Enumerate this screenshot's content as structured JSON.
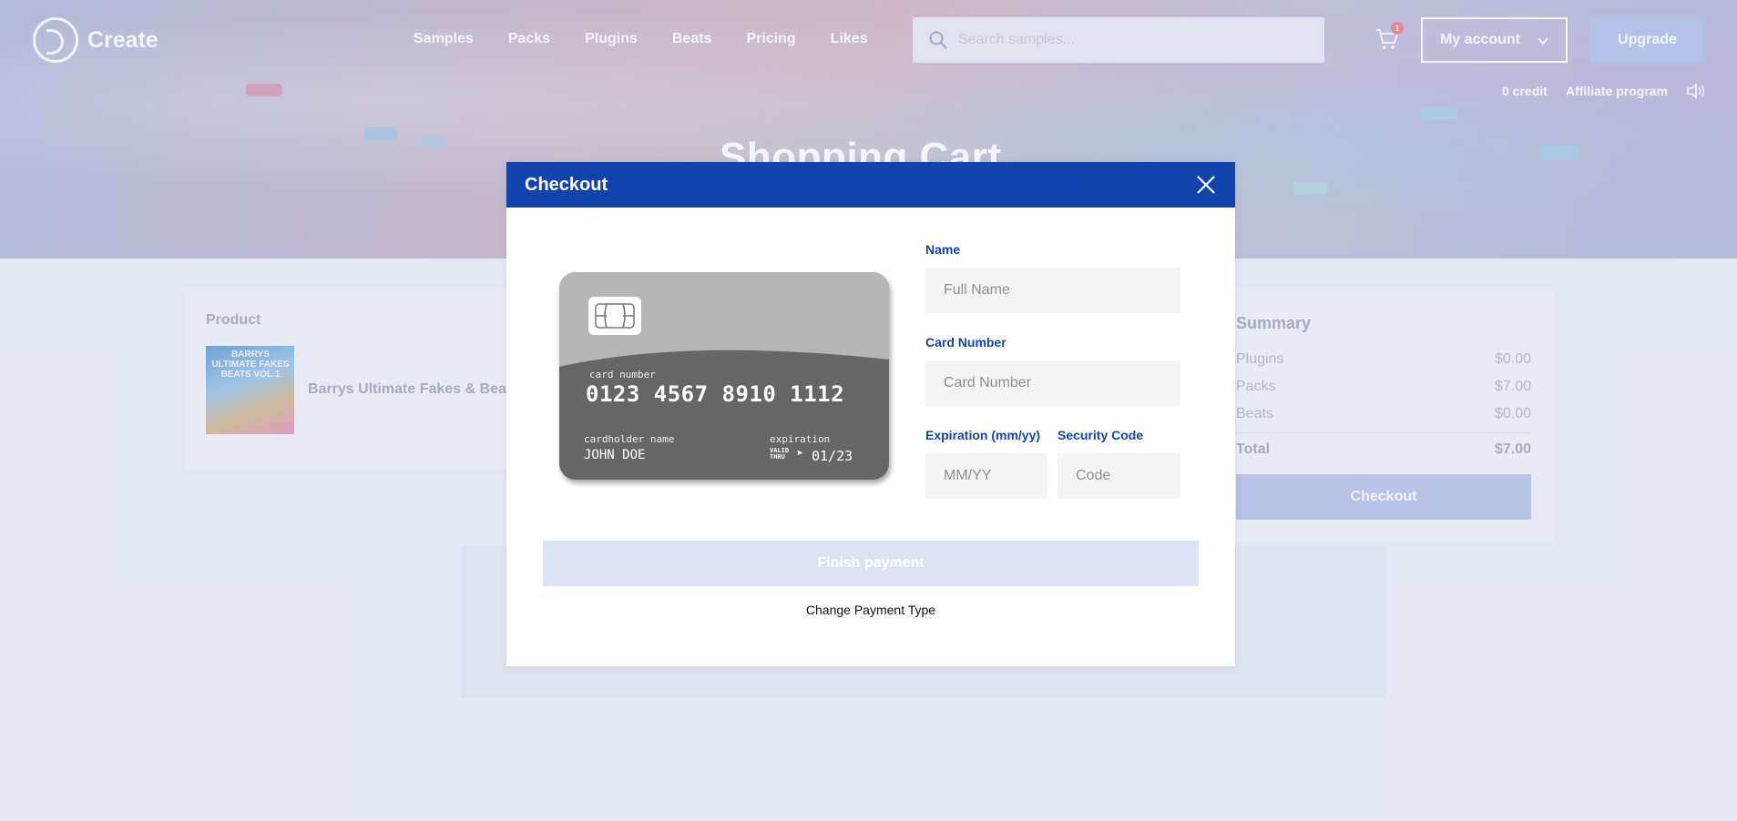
{
  "brand": {
    "name": "Create"
  },
  "nav": {
    "items": [
      "Samples",
      "Packs",
      "Plugins",
      "Beats",
      "Pricing",
      "Likes"
    ]
  },
  "search": {
    "placeholder": "Search samples..."
  },
  "cart": {
    "count": "1"
  },
  "account": {
    "label": "My account"
  },
  "upgrade": {
    "label": "Upgrade"
  },
  "subnav": {
    "credit": "0 credit",
    "affiliate": "Affiliate program"
  },
  "hero": {
    "title": "Shopping Cart"
  },
  "product": {
    "header": "Product",
    "name": "Barrys Ultimate Fakes & Beats",
    "cover_text": "BARRYS ULTIMATE FAKES BEATS VOL.1"
  },
  "summary": {
    "header": "Summary",
    "rows": [
      {
        "label": "Plugins",
        "value": "$0.00"
      },
      {
        "label": "Packs",
        "value": "$7.00"
      },
      {
        "label": "Beats",
        "value": "$0.00"
      }
    ],
    "total_label": "Total",
    "total_value": "$7.00",
    "checkout_label": "Checkout"
  },
  "modal": {
    "title": "Checkout",
    "card": {
      "number_label": "card number",
      "number": "0123 4567 8910 1112",
      "holder_label": "cardholder name",
      "holder": "JOHN DOE",
      "expiration_label": "expiration",
      "valid_thru": "VALID THRU",
      "expiration": "01/23"
    },
    "fields": {
      "name_label": "Name",
      "name_placeholder": "Full Name",
      "card_label": "Card Number",
      "card_placeholder": "Card Number",
      "exp_label": "Expiration (mm/yy)",
      "exp_placeholder": "MM/YY",
      "code_label": "Security Code",
      "code_placeholder": "Code"
    },
    "finish_label": "Finish payment",
    "change_label": "Change Payment Type"
  },
  "colors": {
    "primary": "#1343ad",
    "modal_bg": "#ffffff",
    "finish_disabled": "#dde3f3",
    "page_bg": "#e8ebf3"
  }
}
